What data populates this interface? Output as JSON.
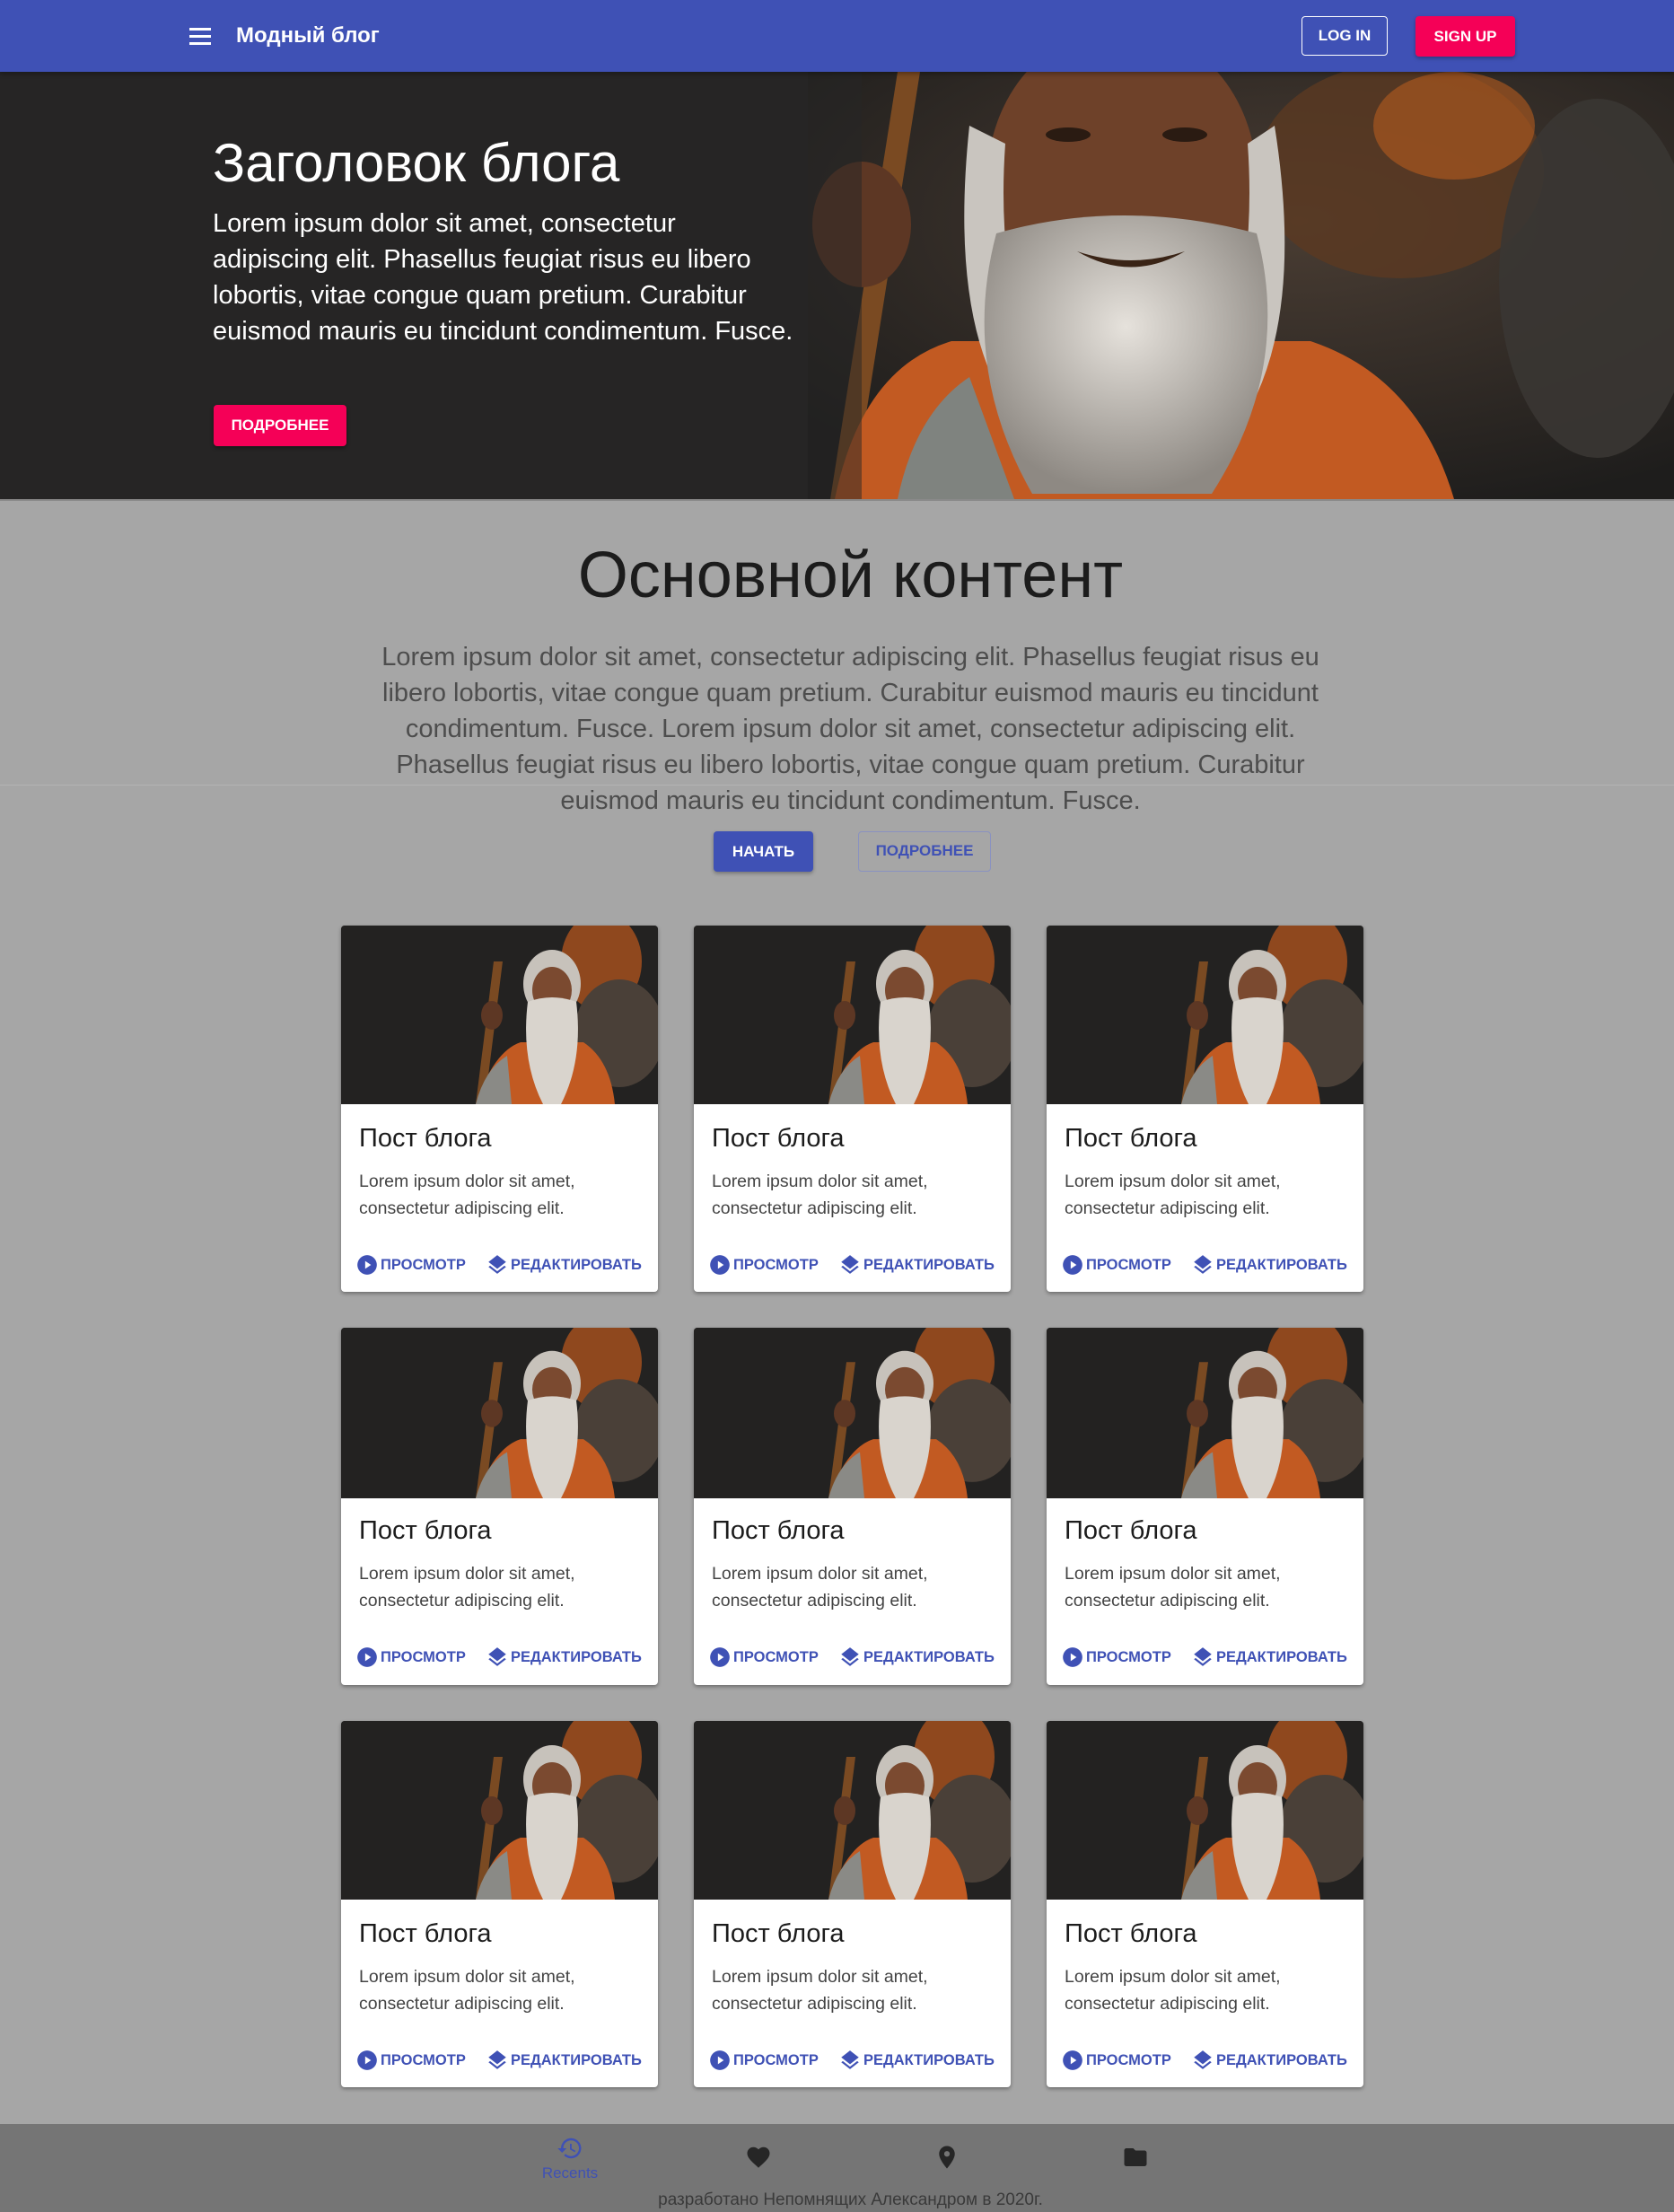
{
  "appbar": {
    "title": "Модный блог",
    "login_label": "LOG IN",
    "signup_label": "SIGN UP",
    "color": "#3f51b5",
    "accent": "#f50057"
  },
  "hero": {
    "title": "Заголовок блога",
    "text": "Lorem ipsum dolor sit amet, consectetur adipiscing elit. Phasellus feugiat risus eu libero lobortis, vitae congue quam pretium. Curabitur euismod mauris eu tincidunt condimentum. Fusce.",
    "button_label": "ПОДРОБНЕЕ"
  },
  "main": {
    "title": "Основной контент",
    "text": "Lorem ipsum dolor sit amet, consectetur adipiscing elit. Phasellus feugiat risus eu libero lobortis, vitae congue quam pretium. Curabitur euismod mauris eu tincidunt condimentum. Fusce. Lorem ipsum dolor sit amet, consectetur adipiscing elit. Phasellus feugiat risus eu libero lobortis, vitae congue quam pretium. Curabitur euismod mauris eu tincidunt condimentum. Fusce.",
    "start_label": "НАЧАТЬ",
    "more_label": "ПОДРОБНЕЕ"
  },
  "cards": [
    {
      "title": "Пост блога",
      "text": "Lorem ipsum dolor sit amet, consectetur adipiscing elit.",
      "view_label": "ПРОСМОТР",
      "edit_label": "РЕДАКТИРОВАТЬ"
    },
    {
      "title": "Пост блога",
      "text": "Lorem ipsum dolor sit amet, consectetur adipiscing elit.",
      "view_label": "ПРОСМОТР",
      "edit_label": "РЕДАКТИРОВАТЬ"
    },
    {
      "title": "Пост блога",
      "text": "Lorem ipsum dolor sit amet, consectetur adipiscing elit.",
      "view_label": "ПРОСМОТР",
      "edit_label": "РЕДАКТИРОВАТЬ"
    },
    {
      "title": "Пост блога",
      "text": "Lorem ipsum dolor sit amet, consectetur adipiscing elit.",
      "view_label": "ПРОСМОТР",
      "edit_label": "РЕДАКТИРОВАТЬ"
    },
    {
      "title": "Пост блога",
      "text": "Lorem ipsum dolor sit amet, consectetur adipiscing elit.",
      "view_label": "ПРОСМОТР",
      "edit_label": "РЕДАКТИРОВАТЬ"
    },
    {
      "title": "Пост блога",
      "text": "Lorem ipsum dolor sit amet, consectetur adipiscing elit.",
      "view_label": "ПРОСМОТР",
      "edit_label": "РЕДАКТИРОВАТЬ"
    },
    {
      "title": "Пост блога",
      "text": "Lorem ipsum dolor sit amet, consectetur adipiscing elit.",
      "view_label": "ПРОСМОТР",
      "edit_label": "РЕДАКТИРОВАТЬ"
    },
    {
      "title": "Пост блога",
      "text": "Lorem ipsum dolor sit amet, consectetur adipiscing elit.",
      "view_label": "ПРОСМОТР",
      "edit_label": "РЕДАКТИРОВАТЬ"
    },
    {
      "title": "Пост блога",
      "text": "Lorem ipsum dolor sit amet, consectetur adipiscing elit.",
      "view_label": "ПРОСМОТР",
      "edit_label": "РЕДАКТИРОВАТЬ"
    }
  ],
  "bottom_nav": {
    "items": [
      {
        "icon": "history-icon",
        "label": "Recents",
        "selected": true
      },
      {
        "icon": "heart-icon",
        "label": "",
        "selected": false
      },
      {
        "icon": "location-pin-icon",
        "label": "",
        "selected": false
      },
      {
        "icon": "folder-icon",
        "label": "",
        "selected": false
      }
    ]
  },
  "footer": {
    "text": "разработано Непомнящих Александром в 2020г."
  }
}
